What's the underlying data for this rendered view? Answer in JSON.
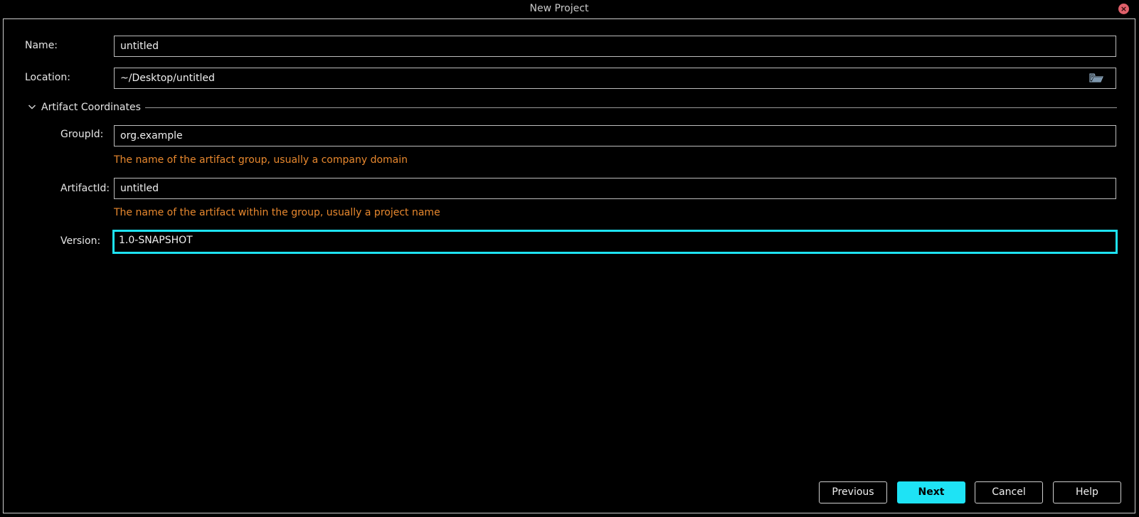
{
  "window": {
    "title": "New Project",
    "close_glyph": "×"
  },
  "form": {
    "name": {
      "label": "Name:",
      "value": "untitled"
    },
    "location": {
      "label": "Location:",
      "value": "~/Desktop/untitled",
      "browse_icon": "folder-icon"
    },
    "artifact_section": {
      "title": "Artifact Coordinates",
      "expanded": true,
      "group_id": {
        "label": "GroupId:",
        "value": "org.example",
        "hint": "The name of the artifact group, usually a company domain"
      },
      "artifact_id": {
        "label": "ArtifactId:",
        "value": "untitled",
        "hint": "The name of the artifact within the group, usually a project name"
      },
      "version": {
        "label": "Version:",
        "value": "1.0-SNAPSHOT",
        "focused": true
      }
    }
  },
  "buttons": {
    "previous": "Previous",
    "next": "Next",
    "cancel": "Cancel",
    "help": "Help"
  },
  "colors": {
    "accent": "#1ee3f5",
    "hint": "#e8882e",
    "close": "#e0606a",
    "background": "#000000"
  }
}
